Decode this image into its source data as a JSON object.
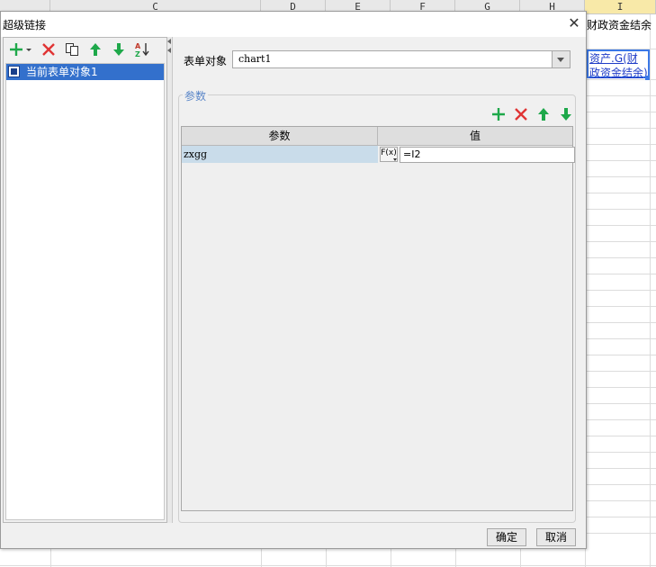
{
  "sheet": {
    "columns": [
      {
        "label": "C"
      },
      {
        "label": "D"
      },
      {
        "label": "E"
      },
      {
        "label": "F"
      },
      {
        "label": "G"
      },
      {
        "label": "H"
      },
      {
        "label": "I"
      }
    ],
    "cell_text": "财政资金结余",
    "cell_link": "资产.G(财政资金结余)"
  },
  "dialog": {
    "title": "超级链接",
    "close_label": "✕",
    "left_toolbar_icons": [
      "add-dropdown-icon",
      "delete-icon",
      "copy-icon",
      "move-up-icon",
      "move-down-icon",
      "sort-icon"
    ],
    "tree": {
      "items": [
        {
          "label": "当前表单对象1",
          "icon": "form-icon"
        }
      ]
    },
    "form": {
      "label": "表单对象",
      "value": "chart1"
    },
    "params": {
      "title": "参数",
      "toolbar_icons": [
        "add-icon",
        "delete-icon",
        "move-up-icon",
        "move-down-icon"
      ],
      "headers": [
        "参数",
        "值"
      ],
      "rows": [
        {
          "name": "zxgg",
          "fx": "F(x)",
          "value": "=I2"
        }
      ]
    },
    "ok_label": "确定",
    "cancel_label": "取消"
  }
}
